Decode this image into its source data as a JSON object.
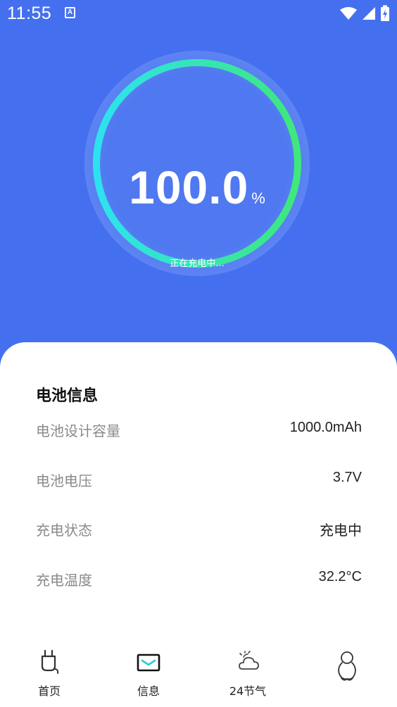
{
  "status_bar": {
    "time": "11:55",
    "app_icon_letter": "A",
    "icons": [
      "wifi-icon",
      "signal-icon",
      "battery-charging-icon"
    ]
  },
  "hero": {
    "percent_value": "100.0",
    "percent_sign": "%",
    "status_text": "正在充电中...",
    "level_fraction": 1.0,
    "colors": {
      "background": "#4470f0",
      "ring_start": "#2de2f0",
      "ring_end": "#3ee87a"
    }
  },
  "battery_info": {
    "title": "电池信息",
    "rows": [
      {
        "label": "电池设计容量",
        "value": "1000.0mAh"
      },
      {
        "label": "电池电压",
        "value": "3.7V"
      },
      {
        "label": "充电状态",
        "value": "充电中"
      },
      {
        "label": "充电温度",
        "value": "32.2°C"
      }
    ]
  },
  "tabbar": {
    "tabs": [
      {
        "label": "首页",
        "icon": "charger-plug-icon"
      },
      {
        "label": "信息",
        "icon": "message-envelope-icon"
      },
      {
        "label": "24节气",
        "icon": "weather-cloud-icon"
      },
      {
        "label": "",
        "icon": "profile-figure-icon"
      }
    ]
  }
}
